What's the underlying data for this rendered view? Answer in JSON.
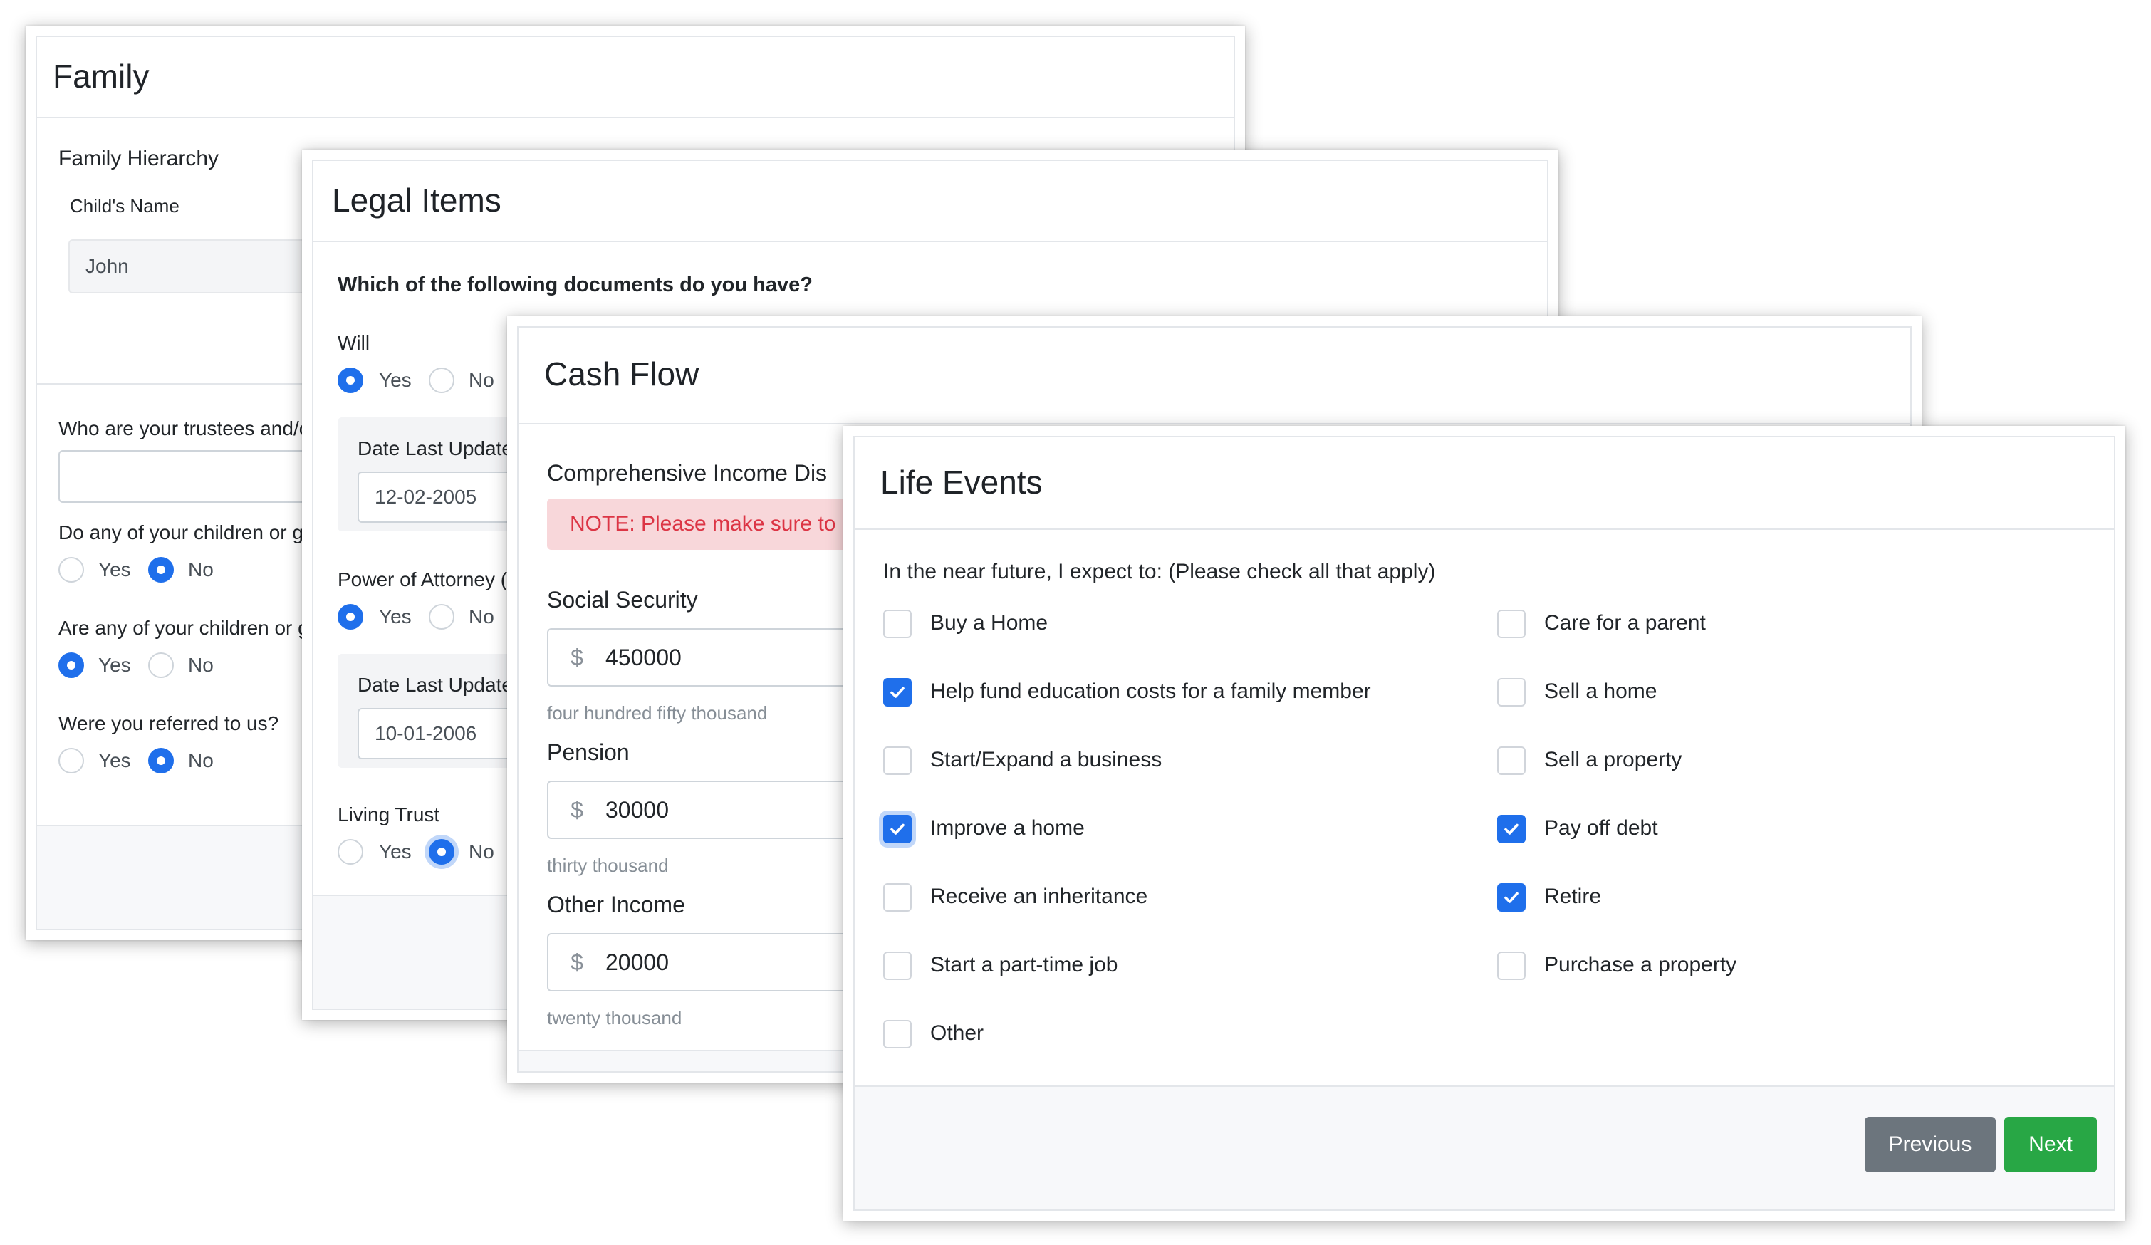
{
  "family": {
    "title": "Family",
    "hierarchy_label": "Family Hierarchy",
    "child_name_label": "Child's Name",
    "child_name_value": "John",
    "trustees_label": "Who are your trustees and/or",
    "q_children_grand": "Do any of your children or gra",
    "q_children_or": "Are any of your children or gr",
    "q_referred": "Were you referred to us?",
    "yes": "Yes",
    "no": "No"
  },
  "legal": {
    "title": "Legal Items",
    "question": "Which of the following documents do you have?",
    "will_label": "Will",
    "date_label_1": "Date Last Update",
    "date_value_1": "12-02-2005",
    "poa_label": "Power of Attorney (",
    "date_label_2": "Date Last Update",
    "date_value_2": "10-01-2006",
    "trust_label": "Living Trust",
    "yes": "Yes",
    "no": "No"
  },
  "cashflow": {
    "title": "Cash Flow",
    "section": "Comprehensive Income Dis",
    "note": "NOTE: Please make sure to e",
    "currency": "$",
    "fields": [
      {
        "label": "Social Security",
        "value": "450000",
        "words": "four hundred fifty thousand"
      },
      {
        "label": "Pension",
        "value": "30000",
        "words": "thirty thousand"
      },
      {
        "label": "Other Income",
        "value": "20000",
        "words": "twenty thousand"
      }
    ]
  },
  "life": {
    "title": "Life Events",
    "question": "In the near future, I expect to: (Please check all that apply)",
    "options": [
      {
        "label": "Buy a Home",
        "checked": false
      },
      {
        "label": "Care for a parent",
        "checked": false
      },
      {
        "label": "Help fund education costs for a family member",
        "checked": true
      },
      {
        "label": "Sell a home",
        "checked": false
      },
      {
        "label": "Start/Expand a business",
        "checked": false
      },
      {
        "label": "Sell a property",
        "checked": false
      },
      {
        "label": "Improve a home",
        "checked": true
      },
      {
        "label": "Pay off debt",
        "checked": true
      },
      {
        "label": "Receive an inheritance",
        "checked": false
      },
      {
        "label": "Retire",
        "checked": true
      },
      {
        "label": "Start a part-time job",
        "checked": false
      },
      {
        "label": "Purchase a property",
        "checked": false
      },
      {
        "label": "Other",
        "checked": false
      }
    ],
    "previous_label": "Previous",
    "next_label": "Next"
  },
  "colors": {
    "accent": "#1f6feb",
    "previous_button": "#6c757d",
    "next_button": "#28a745",
    "alert_bg": "#f8d7da",
    "alert_text": "#dc3545"
  }
}
